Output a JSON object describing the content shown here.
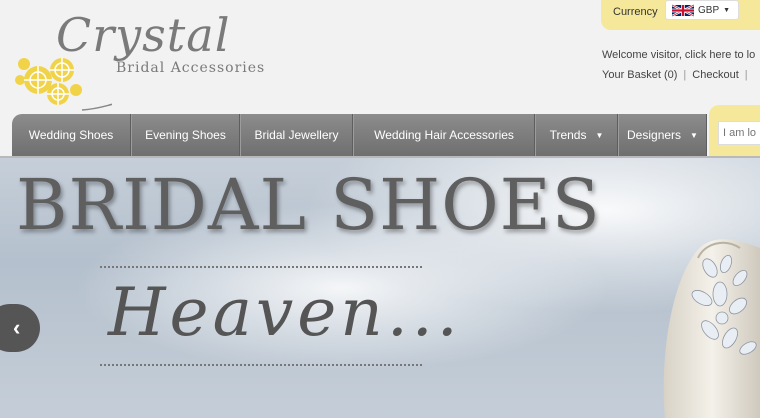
{
  "logo": {
    "title": "Crystal",
    "subtitle": "Bridal Accessories",
    "accent_color": "#f1d34a"
  },
  "currency": {
    "label": "Currency",
    "selected": "GBP",
    "flag_icon": "uk-flag-icon",
    "bar_color": "#f5e89a"
  },
  "account": {
    "welcome": "Welcome visitor, click here to lo",
    "basket": "Your Basket (0)",
    "checkout": "Checkout"
  },
  "nav": {
    "items": [
      {
        "label": "Wedding Shoes",
        "has_dropdown": false
      },
      {
        "label": "Evening Shoes",
        "has_dropdown": false
      },
      {
        "label": "Bridal Jewellery",
        "has_dropdown": false
      },
      {
        "label": "Wedding Hair Accessories",
        "has_dropdown": false
      },
      {
        "label": "Trends",
        "has_dropdown": true
      },
      {
        "label": "Designers",
        "has_dropdown": true
      }
    ],
    "background": "#7a7a7a"
  },
  "search": {
    "placeholder": "I am lo"
  },
  "banner": {
    "title": "BRIDAL SHOES",
    "script": "Heaven...",
    "prev_icon": "chevron-left-icon"
  }
}
